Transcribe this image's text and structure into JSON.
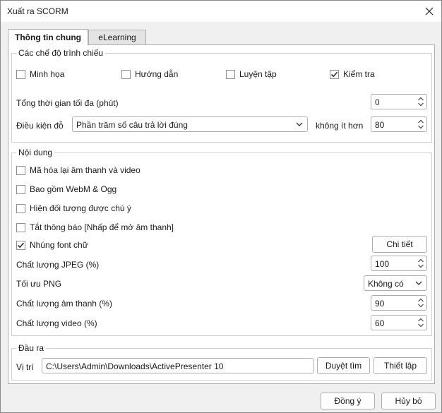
{
  "window": {
    "title": "Xuất ra SCORM"
  },
  "tabs": [
    {
      "label": "Thông tin chung",
      "active": true
    },
    {
      "label": "eLearning",
      "active": false
    }
  ],
  "modes": {
    "group_label": "Các chế độ trình chiếu",
    "items": [
      {
        "label": "Minh họa",
        "checked": false
      },
      {
        "label": "Hướng dẫn",
        "checked": false
      },
      {
        "label": "Luyện tập",
        "checked": false
      },
      {
        "label": "Kiểm tra",
        "checked": true
      }
    ],
    "max_time_label": "Tổng thời gian tối đa (phút)",
    "max_time_value": "0",
    "pass_condition_label": "Điều kiện đỗ",
    "pass_condition_value": "Phần trăm số câu trả lời đúng",
    "not_less_label": "không ít hơn",
    "not_less_value": "80"
  },
  "content": {
    "group_label": "Nội dung",
    "options": [
      {
        "label": "Mã hóa lại âm thanh và video",
        "checked": false
      },
      {
        "label": "Bao gồm WebM & Ogg",
        "checked": false
      },
      {
        "label": "Hiện đối tượng được chú ý",
        "checked": false
      },
      {
        "label": "Tắt thông báo [Nhấp để mở âm thanh]",
        "checked": false
      },
      {
        "label": "Nhúng font chữ",
        "checked": true
      }
    ],
    "details_button": "Chi tiết",
    "jpeg_label": "Chất lượng JPEG (%)",
    "jpeg_value": "100",
    "png_label": "Tối ưu PNG",
    "png_value": "Không có",
    "audio_label": "Chất lượng âm thanh (%)",
    "audio_value": "90",
    "video_label": "Chất lượng video (%)",
    "video_value": "60"
  },
  "output": {
    "group_label": "Đầu ra",
    "location_label": "Vị trí",
    "location_value": "C:\\Users\\Admin\\Downloads\\ActivePresenter 10",
    "browse_button": "Duyệt tìm",
    "settings_button": "Thiết lập"
  },
  "footer": {
    "ok_button": "Đồng ý",
    "cancel_button": "Hủy bỏ"
  }
}
